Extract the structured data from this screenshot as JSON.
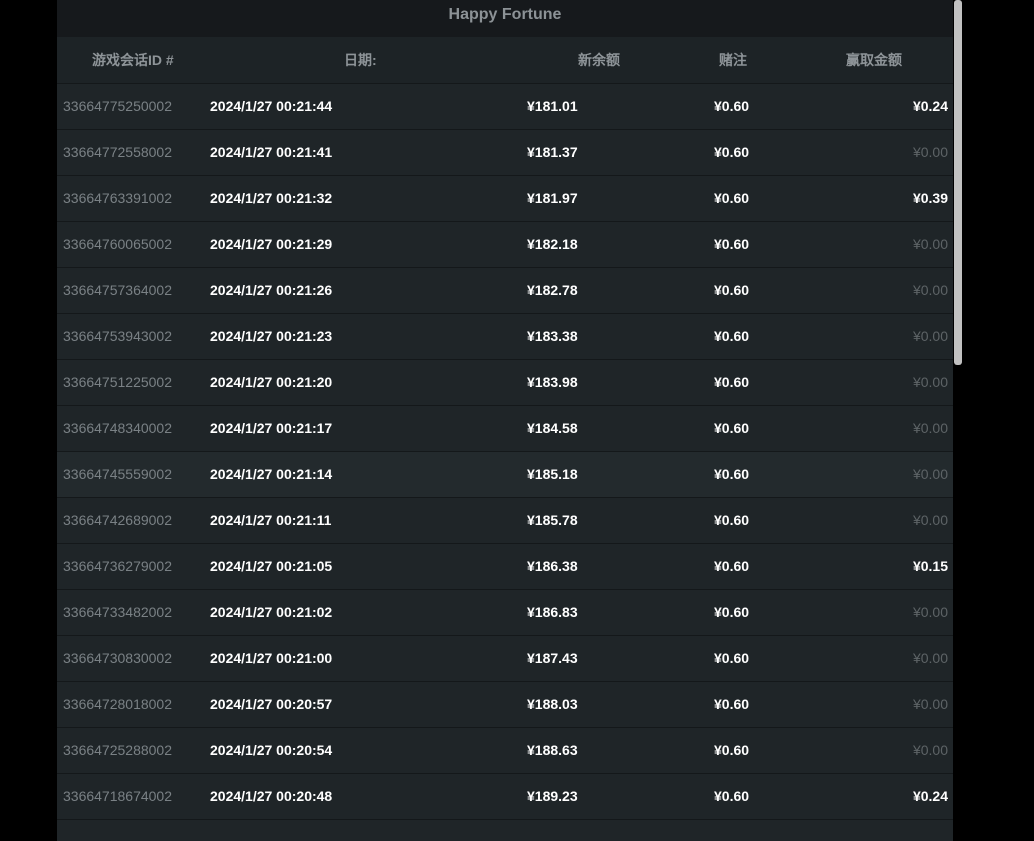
{
  "title": "Happy Fortune",
  "columns": {
    "id": "游戏会话ID #",
    "date": "日期:",
    "balance": "新余额",
    "bet": "赌注",
    "win": "赢取金额"
  },
  "rows": [
    {
      "id": "33664775250002",
      "date": "2024/1/27 00:21:44",
      "balance": "¥181.01",
      "bet": "¥0.60",
      "win": "¥0.24"
    },
    {
      "id": "33664772558002",
      "date": "2024/1/27 00:21:41",
      "balance": "¥181.37",
      "bet": "¥0.60",
      "win": "¥0.00"
    },
    {
      "id": "33664763391002",
      "date": "2024/1/27 00:21:32",
      "balance": "¥181.97",
      "bet": "¥0.60",
      "win": "¥0.39"
    },
    {
      "id": "33664760065002",
      "date": "2024/1/27 00:21:29",
      "balance": "¥182.18",
      "bet": "¥0.60",
      "win": "¥0.00"
    },
    {
      "id": "33664757364002",
      "date": "2024/1/27 00:21:26",
      "balance": "¥182.78",
      "bet": "¥0.60",
      "win": "¥0.00"
    },
    {
      "id": "33664753943002",
      "date": "2024/1/27 00:21:23",
      "balance": "¥183.38",
      "bet": "¥0.60",
      "win": "¥0.00"
    },
    {
      "id": "33664751225002",
      "date": "2024/1/27 00:21:20",
      "balance": "¥183.98",
      "bet": "¥0.60",
      "win": "¥0.00"
    },
    {
      "id": "33664748340002",
      "date": "2024/1/27 00:21:17",
      "balance": "¥184.58",
      "bet": "¥0.60",
      "win": "¥0.00"
    },
    {
      "id": "33664745559002",
      "date": "2024/1/27 00:21:14",
      "balance": "¥185.18",
      "bet": "¥0.60",
      "win": "¥0.00"
    },
    {
      "id": "33664742689002",
      "date": "2024/1/27 00:21:11",
      "balance": "¥185.78",
      "bet": "¥0.60",
      "win": "¥0.00"
    },
    {
      "id": "33664736279002",
      "date": "2024/1/27 00:21:05",
      "balance": "¥186.38",
      "bet": "¥0.60",
      "win": "¥0.15"
    },
    {
      "id": "33664733482002",
      "date": "2024/1/27 00:21:02",
      "balance": "¥186.83",
      "bet": "¥0.60",
      "win": "¥0.00"
    },
    {
      "id": "33664730830002",
      "date": "2024/1/27 00:21:00",
      "balance": "¥187.43",
      "bet": "¥0.60",
      "win": "¥0.00"
    },
    {
      "id": "33664728018002",
      "date": "2024/1/27 00:20:57",
      "balance": "¥188.03",
      "bet": "¥0.60",
      "win": "¥0.00"
    },
    {
      "id": "33664725288002",
      "date": "2024/1/27 00:20:54",
      "balance": "¥188.63",
      "bet": "¥0.60",
      "win": "¥0.00"
    },
    {
      "id": "33664718674002",
      "date": "2024/1/27 00:20:48",
      "balance": "¥189.23",
      "bet": "¥0.60",
      "win": "¥0.24"
    }
  ]
}
